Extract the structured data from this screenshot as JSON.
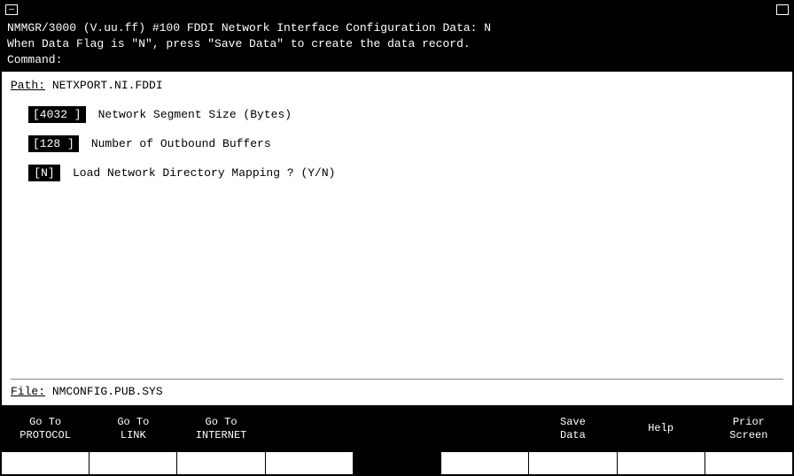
{
  "titlebar": {
    "left_box": "",
    "right_box": ""
  },
  "header": {
    "line1": "NMMGR/3000 (V.uu.ff) #100  FDDI Network Interface Configuration     Data: N",
    "line2": "When Data Flag is \"N\", press \"Save Data\" to create the data record.",
    "line3": "Command:"
  },
  "path": {
    "label": "Path:",
    "value": "NETXPORT.NI.FDDI"
  },
  "fields": [
    {
      "id": "field-network-segment",
      "box_value": "4032 ",
      "label": "Network Segment Size (Bytes)"
    },
    {
      "id": "field-outbound-buffers",
      "box_value": "128 ",
      "label": "Number of Outbound Buffers"
    },
    {
      "id": "field-load-network",
      "box_value": "N",
      "label": "Load Network Directory Mapping ? (Y/N)"
    }
  ],
  "file": {
    "label": "File:",
    "value": "NMCONFIG.PUB.SYS"
  },
  "buttons": [
    {
      "id": "btn-goto-protocol",
      "label": "Go To\nPROTOCOL",
      "empty": false
    },
    {
      "id": "btn-goto-link",
      "label": "Go To\nLINK",
      "empty": false
    },
    {
      "id": "btn-goto-internet",
      "label": "Go To\nINTERNET",
      "empty": false
    },
    {
      "id": "btn-empty-1",
      "label": "",
      "empty": true
    },
    {
      "id": "btn-empty-2",
      "label": "",
      "empty": true
    },
    {
      "id": "btn-empty-3",
      "label": "",
      "empty": true
    },
    {
      "id": "btn-save-data",
      "label": "Save\nData",
      "empty": false
    },
    {
      "id": "btn-help",
      "label": "Help",
      "empty": false
    },
    {
      "id": "btn-prior-screen",
      "label": "Prior\nScreen",
      "empty": false
    }
  ],
  "sub_buttons": [
    {
      "id": "sub-btn-1",
      "label": "",
      "dark": false
    },
    {
      "id": "sub-btn-2",
      "label": "",
      "dark": false
    },
    {
      "id": "sub-btn-3",
      "label": "",
      "dark": false
    },
    {
      "id": "sub-btn-4",
      "label": "",
      "dark": false
    },
    {
      "id": "sub-btn-5",
      "label": "",
      "dark": true
    },
    {
      "id": "sub-btn-6",
      "label": "",
      "dark": false
    },
    {
      "id": "sub-btn-7",
      "label": "",
      "dark": false
    },
    {
      "id": "sub-btn-8",
      "label": "",
      "dark": false
    },
    {
      "id": "sub-btn-9",
      "label": "",
      "dark": false
    }
  ]
}
